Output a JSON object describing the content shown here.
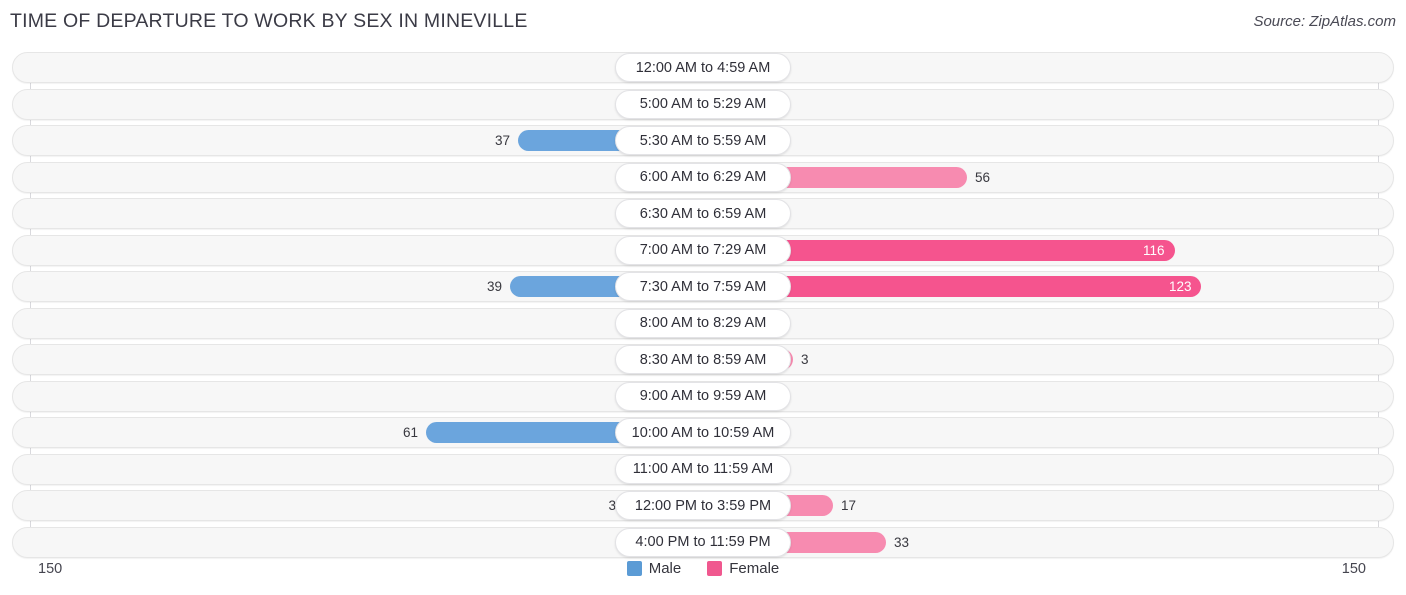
{
  "header": {
    "title": "TIME OF DEPARTURE TO WORK BY SEX IN MINEVILLE",
    "source": "Source: ZipAtlas.com"
  },
  "axis": {
    "min_label": "150",
    "max_label": "150"
  },
  "legend": {
    "items": [
      {
        "label": "Male",
        "color": "#5b9bd5"
      },
      {
        "label": "Female",
        "color": "#f0588f"
      }
    ]
  },
  "colors": {
    "male_strong": "#6ba5dd",
    "male_light": "#aecbeb",
    "female_strong": "#f5548e",
    "female_mid": "#f78bb0",
    "female_light": "#f9a8c4",
    "track_bg": "#f7f7f7",
    "track_border": "#e6e6e6"
  },
  "chart_data": {
    "type": "bar",
    "orientation": "horizontal",
    "style": "diverging-bidirectional",
    "title": "TIME OF DEPARTURE TO WORK BY SEX IN MINEVILLE",
    "xlabel": "",
    "ylabel": "",
    "xlim": [
      150,
      150
    ],
    "grid": false,
    "legend_position": "bottom-center",
    "categories": [
      "12:00 AM to 4:59 AM",
      "5:00 AM to 5:29 AM",
      "5:30 AM to 5:59 AM",
      "6:00 AM to 6:29 AM",
      "6:30 AM to 6:59 AM",
      "7:00 AM to 7:29 AM",
      "7:30 AM to 7:59 AM",
      "8:00 AM to 8:29 AM",
      "8:30 AM to 8:59 AM",
      "9:00 AM to 9:59 AM",
      "10:00 AM to 10:59 AM",
      "11:00 AM to 11:59 AM",
      "12:00 PM to 3:59 PM",
      "4:00 PM to 11:59 PM"
    ],
    "series": [
      {
        "name": "Male",
        "side": "left",
        "values": [
          0,
          0,
          37,
          0,
          0,
          0,
          39,
          0,
          0,
          0,
          61,
          0,
          3,
          0
        ]
      },
      {
        "name": "Female",
        "side": "right",
        "values": [
          0,
          0,
          0,
          56,
          0,
          116,
          123,
          0,
          3,
          0,
          0,
          0,
          17,
          33
        ]
      }
    ]
  },
  "rows": [
    {
      "label": "12:00 AM to 4:59 AM",
      "male": "0",
      "female": "0",
      "male_w": 67,
      "female_w": 67,
      "male_tone": "light",
      "female_tone": "mid",
      "male_inside": false,
      "female_inside": false
    },
    {
      "label": "5:00 AM to 5:29 AM",
      "male": "0",
      "female": "0",
      "male_w": 67,
      "female_w": 67,
      "male_tone": "light",
      "female_tone": "mid",
      "male_inside": false,
      "female_inside": false
    },
    {
      "label": "5:30 AM to 5:59 AM",
      "male": "37",
      "female": "0",
      "male_w": 185,
      "female_w": 67,
      "male_tone": "strong",
      "female_tone": "mid",
      "male_inside": false,
      "female_inside": false
    },
    {
      "label": "6:00 AM to 6:29 AM",
      "male": "0",
      "female": "56",
      "male_w": 67,
      "female_w": 264,
      "male_tone": "light",
      "female_tone": "mid",
      "male_inside": false,
      "female_inside": false
    },
    {
      "label": "6:30 AM to 6:59 AM",
      "male": "0",
      "female": "0",
      "male_w": 67,
      "female_w": 67,
      "male_tone": "light",
      "female_tone": "light",
      "male_inside": false,
      "female_inside": false
    },
    {
      "label": "7:00 AM to 7:29 AM",
      "male": "0",
      "female": "116",
      "male_w": 67,
      "female_w": 472,
      "male_tone": "light",
      "female_tone": "strong",
      "male_inside": false,
      "female_inside": true
    },
    {
      "label": "7:30 AM to 7:59 AM",
      "male": "39",
      "female": "123",
      "male_w": 193,
      "female_w": 498,
      "male_tone": "strong",
      "female_tone": "strong",
      "male_inside": false,
      "female_inside": true
    },
    {
      "label": "8:00 AM to 8:29 AM",
      "male": "0",
      "female": "0",
      "male_w": 67,
      "female_w": 67,
      "male_tone": "light",
      "female_tone": "mid",
      "male_inside": false,
      "female_inside": false
    },
    {
      "label": "8:30 AM to 8:59 AM",
      "male": "0",
      "female": "3",
      "male_w": 67,
      "female_w": 90,
      "male_tone": "light",
      "female_tone": "mid",
      "male_inside": false,
      "female_inside": false
    },
    {
      "label": "9:00 AM to 9:59 AM",
      "male": "0",
      "female": "0",
      "male_w": 67,
      "female_w": 67,
      "male_tone": "light",
      "female_tone": "mid",
      "male_inside": false,
      "female_inside": false
    },
    {
      "label": "10:00 AM to 10:59 AM",
      "male": "61",
      "female": "0",
      "male_w": 277,
      "female_w": 67,
      "male_tone": "strong",
      "female_tone": "mid",
      "male_inside": false,
      "female_inside": false
    },
    {
      "label": "11:00 AM to 11:59 AM",
      "male": "0",
      "female": "0",
      "male_w": 67,
      "female_w": 67,
      "male_tone": "light",
      "female_tone": "mid",
      "male_inside": false,
      "female_inside": false
    },
    {
      "label": "12:00 PM to 3:59 PM",
      "male": "3",
      "female": "17",
      "male_w": 79,
      "female_w": 130,
      "male_tone": "mid",
      "female_tone": "mid",
      "male_inside": false,
      "female_inside": false
    },
    {
      "label": "4:00 PM to 11:59 PM",
      "male": "0",
      "female": "33",
      "male_w": 67,
      "female_w": 183,
      "male_tone": "light",
      "female_tone": "mid",
      "male_inside": false,
      "female_inside": false
    }
  ]
}
